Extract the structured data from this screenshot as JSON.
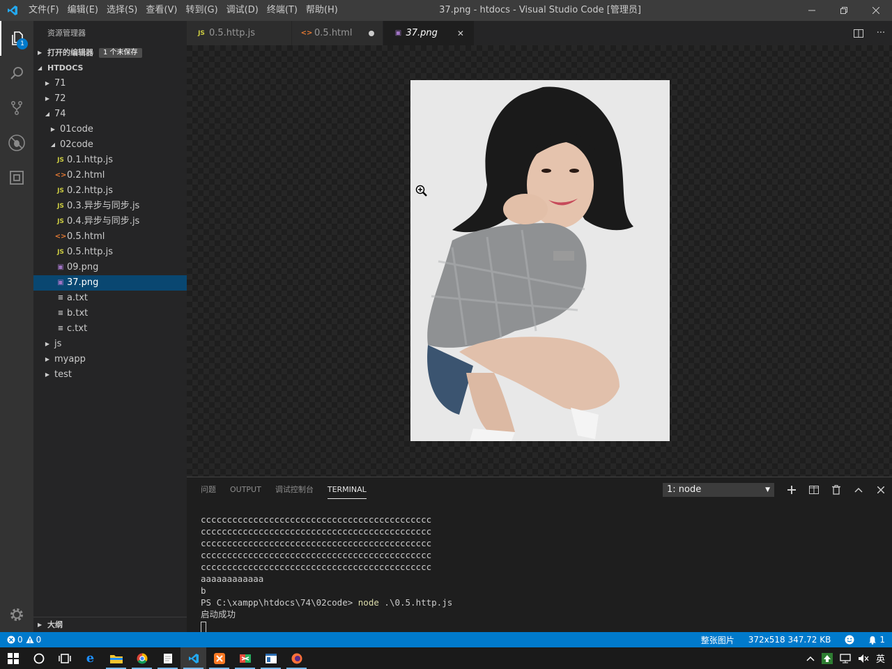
{
  "window": {
    "title": "37.png - htdocs - Visual Studio Code [管理员]",
    "menu": [
      "文件(F)",
      "编辑(E)",
      "选择(S)",
      "查看(V)",
      "转到(G)",
      "调试(D)",
      "终端(T)",
      "帮助(H)"
    ]
  },
  "activity": {
    "explorer_badge": "1"
  },
  "sidebar": {
    "title": "资源管理器",
    "open_editors": {
      "label": "打开的编辑器",
      "badge": "1 个未保存"
    },
    "root": "HTDOCS",
    "tree": [
      {
        "label": "71",
        "type": "folder",
        "depth": 1,
        "expanded": false
      },
      {
        "label": "72",
        "type": "folder",
        "depth": 1,
        "expanded": false
      },
      {
        "label": "74",
        "type": "folder",
        "depth": 1,
        "expanded": true
      },
      {
        "label": "01code",
        "type": "folder",
        "depth": 2,
        "expanded": false
      },
      {
        "label": "02code",
        "type": "folder",
        "depth": 2,
        "expanded": true
      },
      {
        "label": "0.1.http.js",
        "type": "js",
        "depth": 3
      },
      {
        "label": "0.2.html",
        "type": "html",
        "depth": 3
      },
      {
        "label": "0.2.http.js",
        "type": "js",
        "depth": 3
      },
      {
        "label": "0.3.异步与同步.js",
        "type": "js",
        "depth": 3
      },
      {
        "label": "0.4.异步与同步.js",
        "type": "js",
        "depth": 3
      },
      {
        "label": "0.5.html",
        "type": "html",
        "depth": 3
      },
      {
        "label": "0.5.http.js",
        "type": "js",
        "depth": 3
      },
      {
        "label": "09.png",
        "type": "png",
        "depth": 3
      },
      {
        "label": "37.png",
        "type": "png",
        "depth": 3,
        "selected": true
      },
      {
        "label": "a.txt",
        "type": "txt",
        "depth": 3
      },
      {
        "label": "b.txt",
        "type": "txt",
        "depth": 3
      },
      {
        "label": "c.txt",
        "type": "txt",
        "depth": 3
      },
      {
        "label": "js",
        "type": "folder",
        "depth": 1,
        "expanded": false
      },
      {
        "label": "myapp",
        "type": "folder",
        "depth": 1,
        "expanded": false
      },
      {
        "label": "test",
        "type": "folder",
        "depth": 1,
        "expanded": false
      }
    ],
    "outline": "大纲"
  },
  "tabs": [
    {
      "label": "0.5.http.js",
      "type": "js",
      "state": "normal"
    },
    {
      "label": "0.5.html",
      "type": "html",
      "state": "dirty"
    },
    {
      "label": "37.png",
      "type": "png",
      "state": "active"
    }
  ],
  "panel": {
    "tabs": [
      "问题",
      "OUTPUT",
      "调试控制台",
      "TERMINAL"
    ],
    "active_tab": "TERMINAL",
    "terminal_select": "1: node",
    "lines": [
      "cccccccccccccccccccccccccccccccccccccccccccc",
      "cccccccccccccccccccccccccccccccccccccccccccc",
      "cccccccccccccccccccccccccccccccccccccccccccc",
      "cccccccccccccccccccccccccccccccccccccccccccc",
      "cccccccccccccccccccccccccccccccccccccccccccc",
      "aaaaaaaaaaaa",
      "b"
    ],
    "prompt": "PS C:\\xampp\\htdocs\\74\\02code> ",
    "command": "node",
    "command_args": " .\\0.5.http.js",
    "output": "启动成功"
  },
  "statusbar": {
    "errors": "0",
    "warnings": "0",
    "image_label": "整张图片",
    "image_info": "372x518 347.72 KB",
    "notifications": "1"
  },
  "taskbar": {
    "tray_lang": "英"
  },
  "colors": {
    "accent": "#007acc",
    "selection": "#094771"
  }
}
